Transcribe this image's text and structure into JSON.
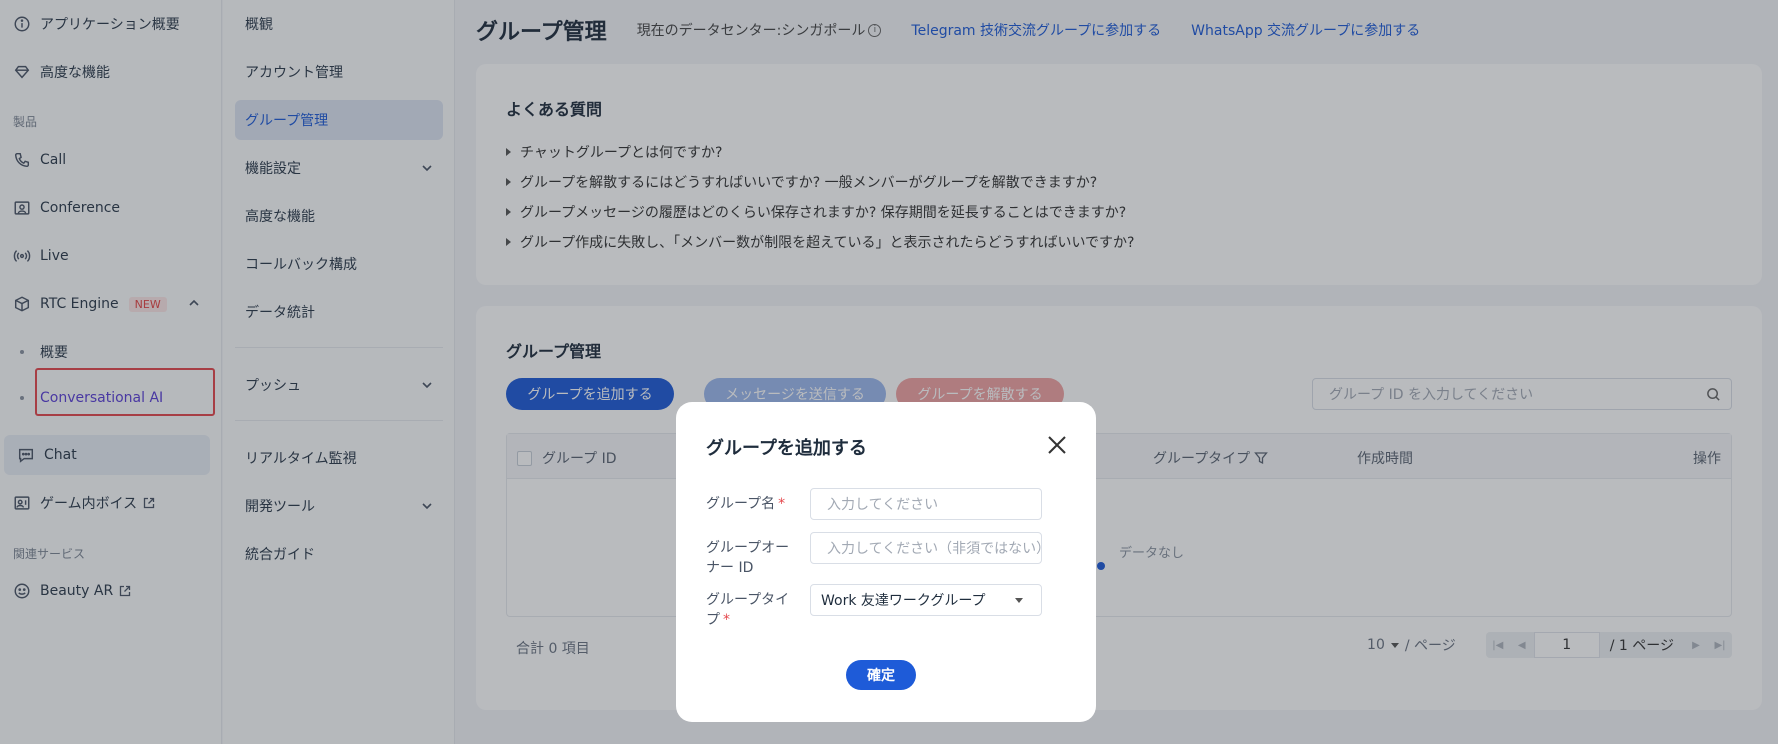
{
  "sidebar": {
    "app_overview": "アプリケーション概要",
    "advanced": "高度な機能",
    "section_products": "製品",
    "call": "Call",
    "conference": "Conference",
    "live": "Live",
    "rtc_engine": "RTC Engine",
    "rtc_badge": "NEW",
    "rtc_sub_overview": "概要",
    "rtc_sub_ai": "Conversational AI",
    "chat": "Chat",
    "game_voice": "ゲーム内ボイス",
    "section_related": "関連サービス",
    "beauty_ar": "Beauty AR"
  },
  "subnav": {
    "items": [
      {
        "label": "概観"
      },
      {
        "label": "アカウント管理"
      },
      {
        "label": "グループ管理"
      },
      {
        "label": "機能設定"
      },
      {
        "label": "高度な機能"
      },
      {
        "label": "コールバック構成"
      },
      {
        "label": "データ統計"
      },
      {
        "label": "プッシュ"
      },
      {
        "label": "リアルタイム監視"
      },
      {
        "label": "開発ツール"
      },
      {
        "label": "統合ガイド"
      }
    ]
  },
  "header": {
    "title": "グループ管理",
    "datacenter": "現在のデータセンター:シンガポール",
    "telegram_link": "Telegram 技術交流グループに参加する",
    "whatsapp_link": "WhatsApp 交流グループに参加する"
  },
  "faq": {
    "title": "よくある質問",
    "items": [
      "チャットグループとは何ですか?",
      "グループを解散するにはどうすればいいですか? 一般メンバーがグループを解散できますか?",
      "グループメッセージの履歴はどのくらい保存されますか? 保存期間を延長することはできますか?",
      "グループ作成に失敗し、「メンバー数が制限を超えている」と表示されたらどうすればいいですか?"
    ]
  },
  "groups": {
    "title": "グループ管理",
    "add_btn": "グループを追加する",
    "msg_btn": "メッセージを送信する",
    "dissolve_btn": "グループを解散する",
    "search_placeholder": "グループ ID を入力してください",
    "columns": {
      "id": "グループ ID",
      "type": "グループタイプ",
      "created": "作成時間",
      "ops": "操作"
    },
    "empty": "データなし",
    "total": "合計  0  項目",
    "page_size": "10",
    "page_size_suffix": "/ ページ",
    "page_current": "1",
    "page_total": "/ 1 ページ"
  },
  "modal": {
    "title": "グループを追加する",
    "name_label": "グループ名",
    "name_placeholder": "入力してください",
    "owner_label": "グループオーナー ID",
    "owner_placeholder": "入力してください（非須ではない）",
    "type_label": "グループタイプ",
    "type_value": "Work 友達ワークグループ",
    "confirm": "確定"
  }
}
